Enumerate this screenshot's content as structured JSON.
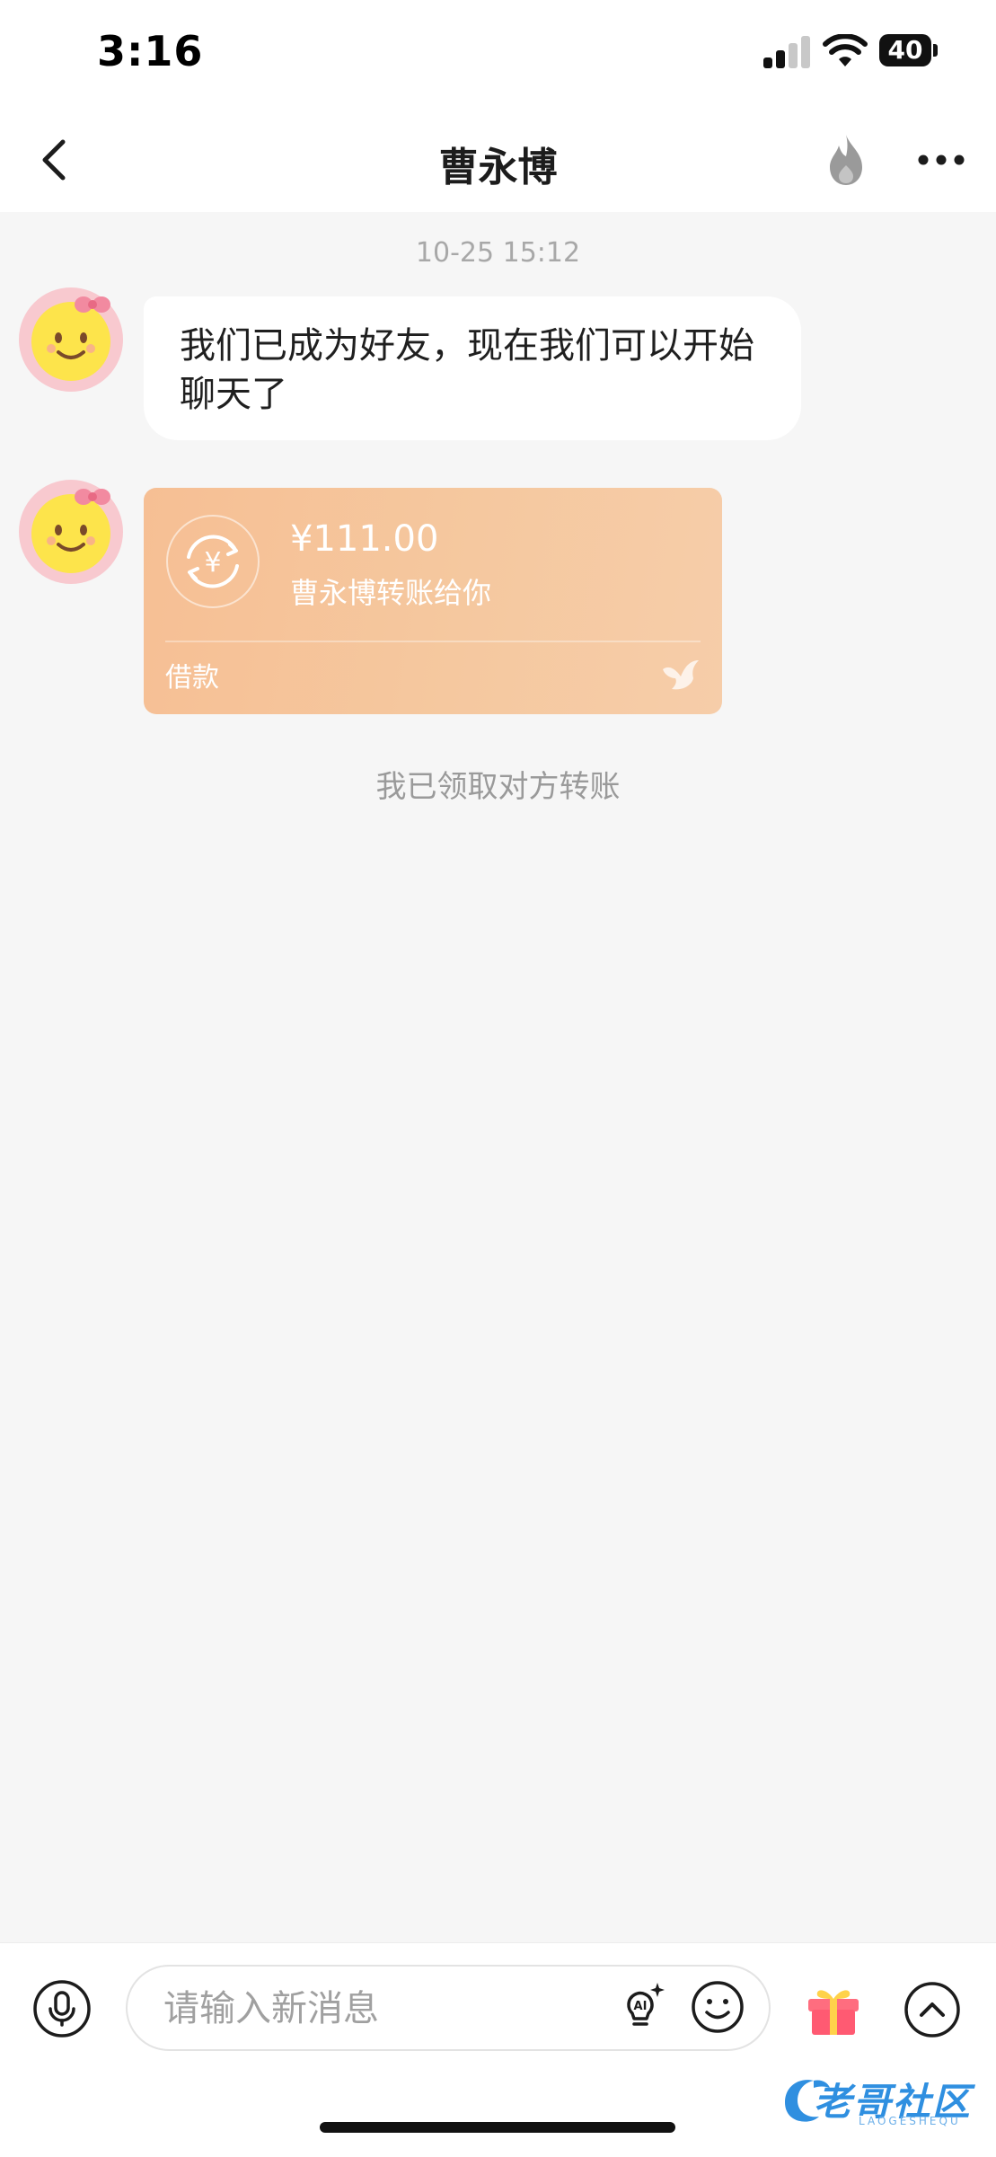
{
  "status_bar": {
    "time": "3:16",
    "battery": "40"
  },
  "header": {
    "title": "曹永博"
  },
  "chat": {
    "timestamp": "10-25 15:12",
    "messages": [
      {
        "type": "text",
        "text": "我们已成为好友，现在我们可以开始聊天了"
      },
      {
        "type": "transfer",
        "amount": "¥111.00",
        "description": "曹永博转账给你",
        "note": "借款"
      }
    ],
    "system_note": "我已领取对方转账"
  },
  "input_bar": {
    "placeholder": "请输入新消息",
    "value": ""
  },
  "watermark": {
    "text": "老哥社区",
    "sub": "LAOGESHEQU"
  },
  "colors": {
    "transfer_card": "#f6c39a",
    "background": "#f6f6f6",
    "avatar_ring": "#f8c9cf",
    "avatar_face": "#fde44b"
  }
}
